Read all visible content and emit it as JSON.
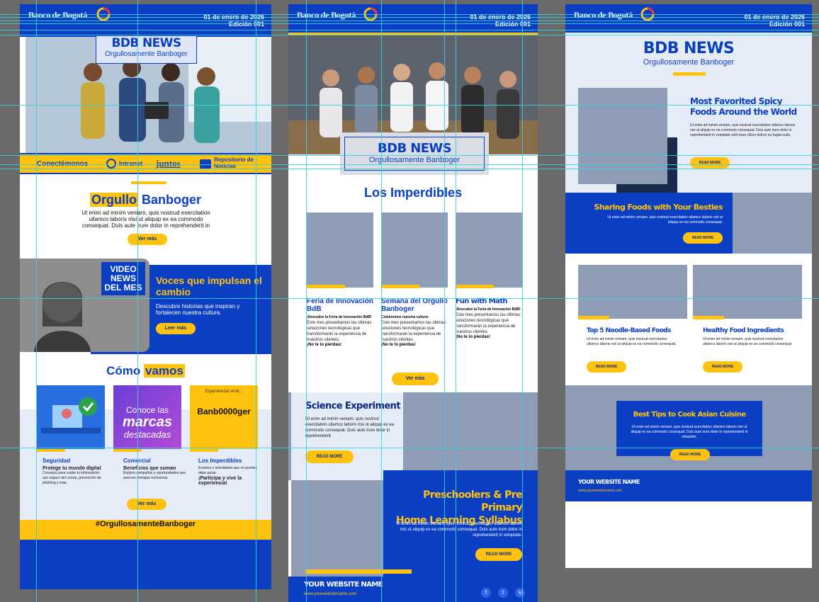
{
  "brand": {
    "name": "Banco de Bogotá",
    "date": "01 de enero de 2026",
    "edition": "Edición 001"
  },
  "news": {
    "title": "BDB NEWS",
    "subtitle": "Orgullosamente Banboger"
  },
  "colors": {
    "blue": "#0a3fc4",
    "yellow": "#ffc20e",
    "gray": "#8e9db5",
    "guide": "#35d2e0"
  },
  "col1": {
    "nav": {
      "connect": "Conectémonos",
      "intranet": "Intranet",
      "juntos": "juntos",
      "repo": "Repositorio de Noticias"
    },
    "orgullo": {
      "title_a": "Orgullo",
      "title_b": "Banboger",
      "body": "Ut enim ad minim veniam, quis nostrud exercitation ullamco laboris nisi ut aliquip ex ea commodo consequat. Duis aute irure dolor in reprehenderit in",
      "button": "Ver más"
    },
    "video": {
      "badge": "VIDEO NEWS DEL MES",
      "title": "Voces que impulsan el cambio",
      "body": "Descubre historias que inspiran y fortalecen nuestra cultura.",
      "button": "Leer más"
    },
    "como": {
      "title_a": "Cómo",
      "title_b": "vamos"
    },
    "tiles": [
      {
        "title": "Seguridad",
        "sub": "Protege tu mundo digital",
        "body": "Consejos para cuidar tu información: uso seguro del correo, prevención de phishing y más."
      },
      {
        "title": "Comercial",
        "sub": "Beneficios que suman",
        "body": "Explora campañas y oportunidades que acercan ventajas exclusivas."
      },
      {
        "title": "Los Imperdibles",
        "sub": "¡Participa y vive la experiencia!",
        "body": "Eventos y actividades que no puedes dejar pasar."
      }
    ],
    "tile_art": {
      "marcas_a": "Conoce las",
      "marcas_b": "marcas",
      "marcas_c": "destacadas",
      "banboger": "Banb0000ger",
      "arc": "Experiencias emb..."
    },
    "more_button": "Ver más",
    "hashtag": "#OrgullosamenteBanboger"
  },
  "col2": {
    "imperdibles": "Los Imperdibles",
    "cards": [
      {
        "title": "Feria de Innovación BdB",
        "lead": "¡Descubre la Feria de Innovación BdB!",
        "body": "Este mes presentamos las últimas soluciones tecnológicas que transformarán la experiencia de nuestros clientes.",
        "cta": "¡No te lo pierdas!"
      },
      {
        "title": "Semana del Orgullo Banboger",
        "lead": "Celebremos nuestra cultura",
        "body": "Este mes presentamos las últimas soluciones tecnológicas que transformarán la experiencia de nuestros clientes.",
        "cta": "¡No te lo pierdas!"
      },
      {
        "title": "Fun with Math",
        "lead": "¡Descubre la Feria de Innovación BdB!",
        "body": "Este mes presentamos las últimas soluciones tecnológicas que transformarán la experiencia de nuestros clientes.",
        "cta": "¡No te lo pierdas!"
      }
    ],
    "more_button": "Ver más",
    "science": {
      "title": "Science Experiment",
      "body": "Ut enim ad minim veniam, quis nostrud exercitation ullamco laboris nisi ut aliquip ex ea commodo consequat. Duis aute irure dolor in reprehenderit.",
      "button": "READ MORE"
    },
    "preschool": {
      "title_1": "Preschoolers & Pre Primary",
      "title_2": "Home Learning Syllabus",
      "body": "Ut enim ad minim veniam, quis nostrud exercitation ullamco laboris nisi ut aliquip ex ea commodo consequat. Duis aute irure dolor in reprehenderit in voluptate.",
      "button": "READ MORE"
    },
    "footer": {
      "site": "YOUR WEBSITE NAME",
      "url": "www.yourwebsitename.com",
      "social": [
        "f",
        "t",
        "ig"
      ]
    }
  },
  "col3": {
    "spicy": {
      "title": "Most Favorited Spicy Foods Around the World",
      "body": "Ut enim ad minim veniam, quis nostrud exercitation ullamco laboris nisi ut aliquip ex ea commodo consequat. Duis aute irure dolor in reprehenderit in voluptate velit esse cillum dolore eu fugiat nulla.",
      "button": "READ MORE"
    },
    "sharing": {
      "title": "Sharing Foods with Your Besties",
      "body": "Ut enim ad minim veniam, quis nostrud exercitation ullamco laboris nisi ut aliquip ex ea commodo consequat.",
      "button": "READ MORE"
    },
    "cards": [
      {
        "title": "Top 5 Noodle-Based Foods",
        "body": "Ut enim ad minim veniam, quis nostrud exercitation ullamco laboris nisi ut aliquip ex ea commodo consequat.",
        "button": "READ MORE"
      },
      {
        "title": "Healthy Food Ingredients",
        "body": "Ut enim ad minim veniam, quis nostrud exercitation ullamco laboris nisi ut aliquip ex ea commodo consequat.",
        "button": "READ MORE"
      }
    ],
    "asian": {
      "title": "Best Tips to Cook Asian Cuisine",
      "body": "Ut enim ad minim veniam, quis nostrud exercitation ullamco laboris nisi ut aliquip ex ea commodo consequat. Duis aute irure dolor in reprehenderit in voluptate.",
      "button": "READ MORE"
    },
    "footer": {
      "site": "YOUR WEBSITE NAME",
      "url": "www.yourwebsitename.com"
    }
  }
}
